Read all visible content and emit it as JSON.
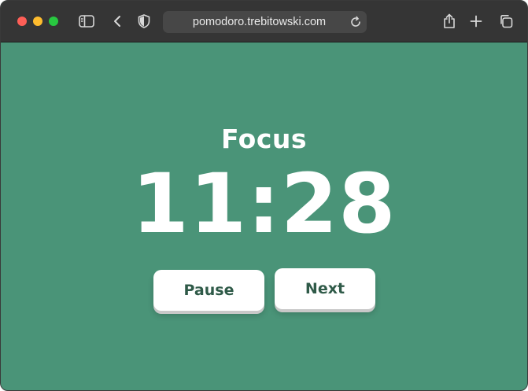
{
  "browser": {
    "url": "pomodoro.trebitowski.com",
    "icons": [
      "sidebar-icon",
      "back-icon",
      "shield-icon",
      "reload-icon",
      "share-icon",
      "new-tab-icon",
      "tab-overview-icon"
    ]
  },
  "timer": {
    "mode": "Focus",
    "time": "11:28"
  },
  "controls": {
    "pause_label": "Pause",
    "next_label": "Next"
  },
  "colors": {
    "background": "#4a9478",
    "button_text": "#2f5a48",
    "toolbar": "#353535"
  }
}
